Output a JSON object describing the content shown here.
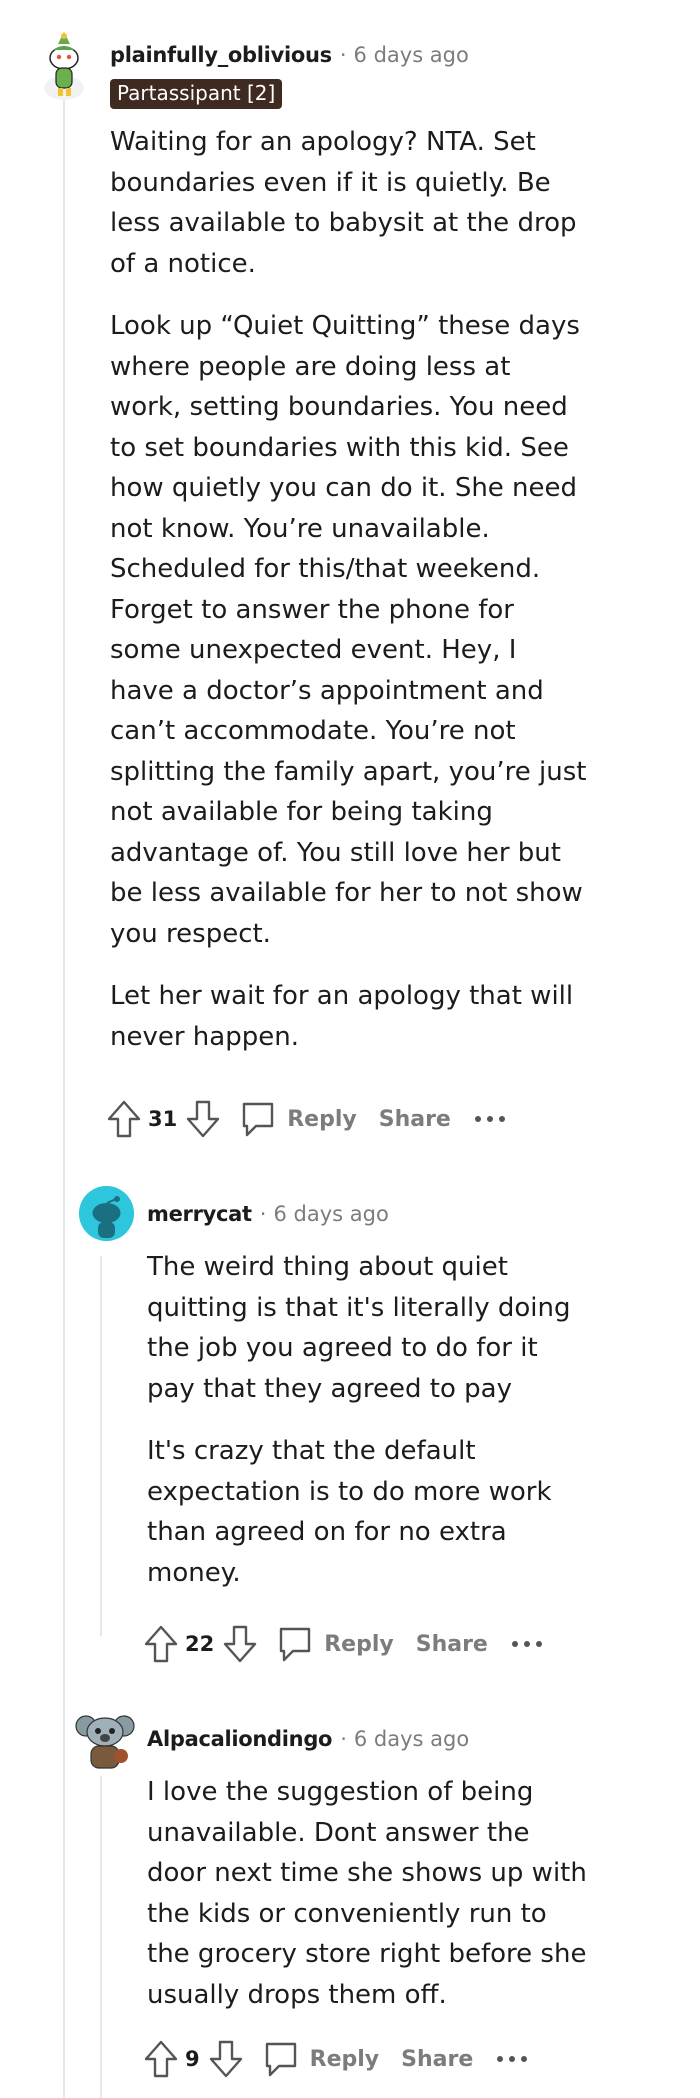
{
  "comments": [
    {
      "username": "plainfully_oblivious",
      "separator": "·",
      "time": "6 days ago",
      "flair": "Partassipant [2]",
      "paragraphs": [
        "Waiting for an apology? NTA. Set boundaries even if it is quietly. Be less available to babysit at the drop of a notice.",
        "Look up “Quiet Quitting” these days where people are doing less at work, setting boundaries. You need to set boundaries with this kid. See how quietly you can do it. She need not know. You’re unavailable. Scheduled for this/that weekend. Forget to answer the phone for some unexpected event. Hey, I have a doctor’s appointment and can’t accommodate. You’re not splitting the family apart, you’re just not available for being taking advantage of. You still love her but be less available for her to not show you respect.",
        "Let her wait for an apology that will never happen."
      ],
      "score": "31",
      "reply_label": "Reply",
      "share_label": "Share",
      "avatar_icon": "snoo-plant-avatar-icon"
    },
    {
      "username": "merrycat",
      "separator": "·",
      "time": "6 days ago",
      "paragraphs": [
        "The weird thing about quiet quitting is that it's literally doing the job you agreed to do for it pay that they agreed to pay",
        "It's crazy that the default expectation is to do more work than agreed on for no extra money."
      ],
      "score": "22",
      "reply_label": "Reply",
      "share_label": "Share",
      "avatar_icon": "default-snoo-avatar-icon"
    },
    {
      "username": "Alpacaliondingo",
      "separator": "·",
      "time": "6 days ago",
      "paragraphs": [
        "I love the suggestion of being unavailable. Dont answer the door next time she shows up with the kids or conveniently run to the grocery store right before she usually drops them off."
      ],
      "score": "9",
      "reply_label": "Reply",
      "share_label": "Share",
      "avatar_icon": "koala-snoo-avatar-icon"
    }
  ],
  "icons": {
    "upvote": "upvote-arrow-icon",
    "downvote": "downvote-arrow-icon",
    "comment": "comment-bubble-icon",
    "more": "more-options-icon"
  },
  "colors": {
    "flair_bg": "#3f2a21",
    "muted": "#7c7c7c",
    "thread_line": "#e5e7ea",
    "default_avatar_bg": "#2ec6dd"
  }
}
